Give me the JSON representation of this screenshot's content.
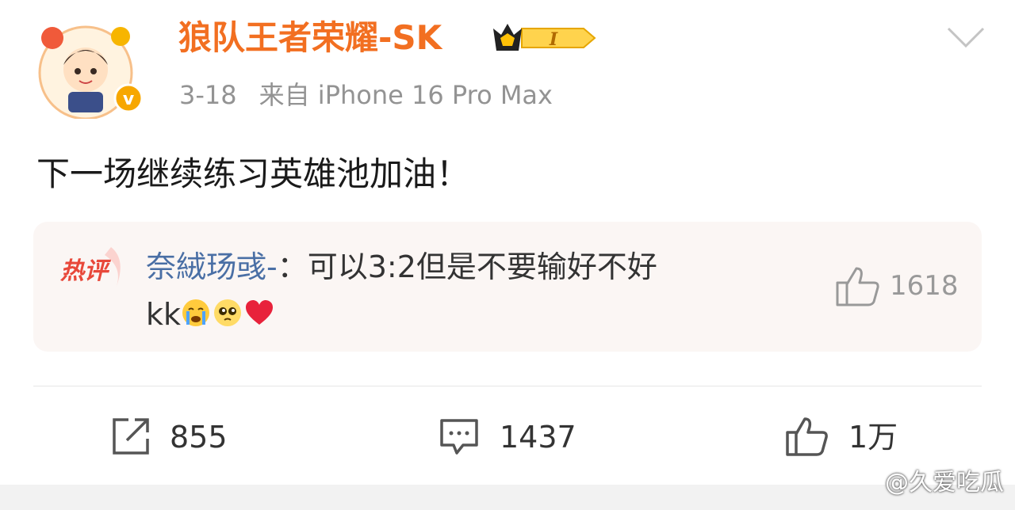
{
  "post": {
    "author": "狼队王者荣耀-SK",
    "badge_level": "I",
    "date": "3-18",
    "source": "来自 iPhone 16 Pro Max",
    "text": "下一场继续练习英雄池加油！"
  },
  "hot_comment": {
    "label": "热评",
    "commenter": "奈絨玚彧-",
    "separator": "：",
    "text_line1": "可以3:2但是不要输好不好",
    "text_line2": "kk",
    "likes": "1618"
  },
  "actions": {
    "repost_count": "855",
    "comment_count": "1437",
    "like_count": "1万"
  },
  "watermark": "@久爱吃瓜",
  "colors": {
    "author": "#f26f21",
    "commenter": "#4a6fa5",
    "meta": "#939393",
    "hot_box_bg": "#fbf6f4"
  }
}
